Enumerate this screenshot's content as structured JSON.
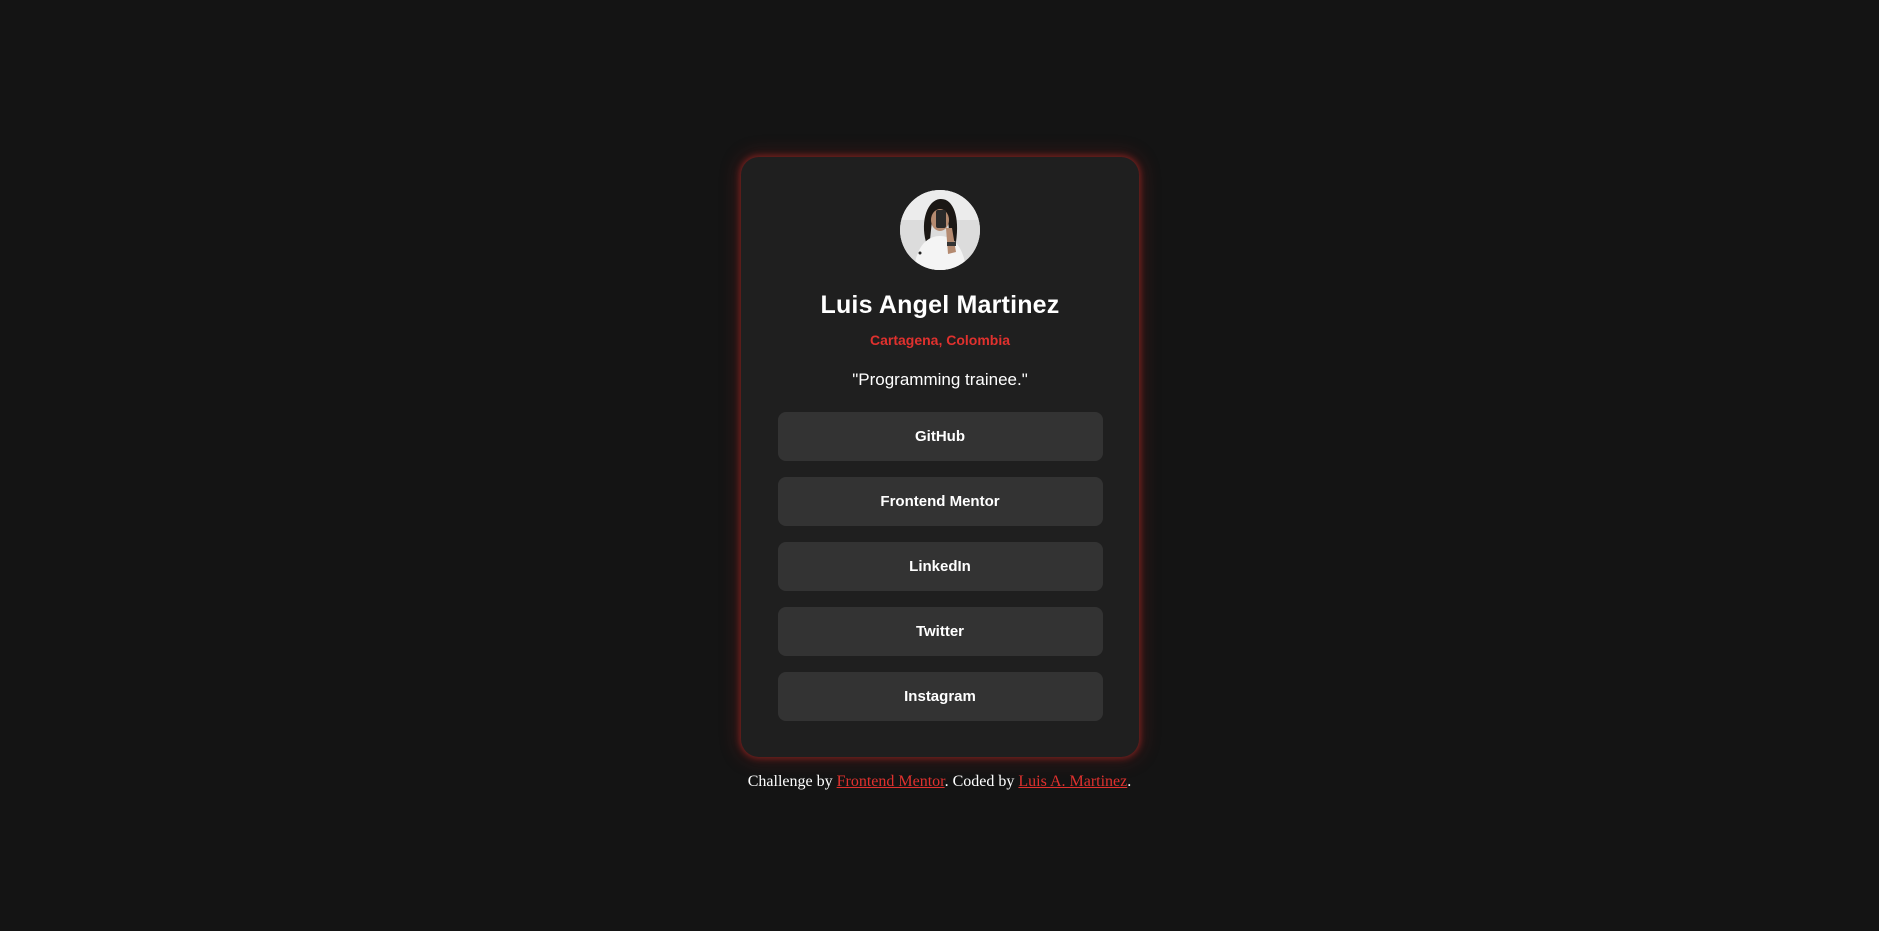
{
  "colors": {
    "page_background": "#141414",
    "card_background": "#1f1f1f",
    "button_background": "#333333",
    "accent": "#e0312e",
    "text": "#ffffff"
  },
  "profile": {
    "avatar_icon": "profile-photo",
    "name": "Luis Angel Martinez",
    "location": "Cartagena, Colombia",
    "bio": "\"Programming trainee.\""
  },
  "links": [
    {
      "label": "GitHub"
    },
    {
      "label": "Frontend Mentor"
    },
    {
      "label": "LinkedIn"
    },
    {
      "label": "Twitter"
    },
    {
      "label": "Instagram"
    }
  ],
  "attribution": {
    "prefix": "Challenge by ",
    "challenge_link": "Frontend Mentor",
    "middle": ". Coded by ",
    "author_link": "Luis A. Martinez",
    "suffix": "."
  }
}
